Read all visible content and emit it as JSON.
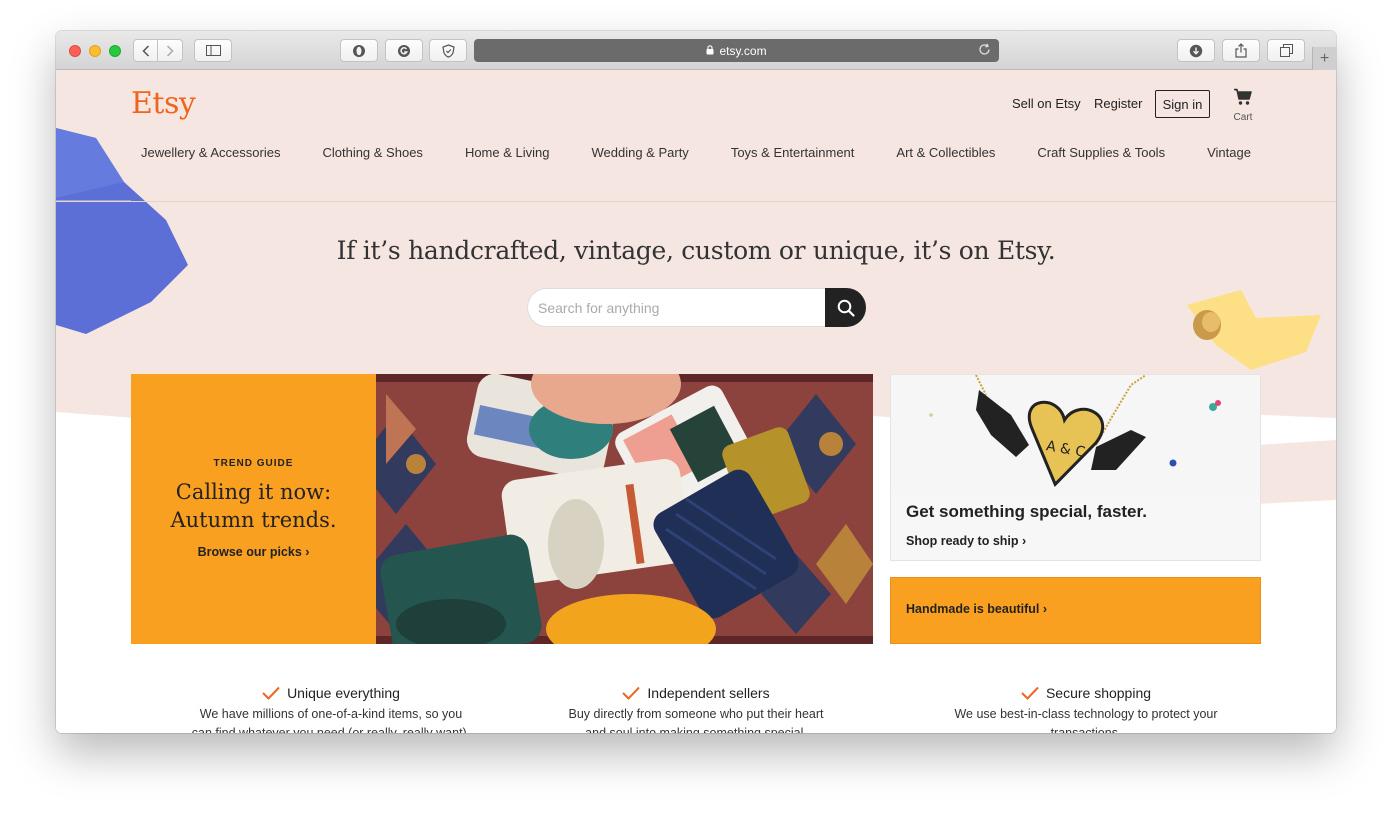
{
  "browser": {
    "url": "etsy.com",
    "new_tab_symbol": "+"
  },
  "header": {
    "logo": "Etsy",
    "sell_link": "Sell on Etsy",
    "register_link": "Register",
    "sign_in": "Sign in",
    "cart_label": "Cart"
  },
  "categories": [
    "Jewellery & Accessories",
    "Clothing & Shoes",
    "Home & Living",
    "Wedding & Party",
    "Toys & Entertainment",
    "Art & Collectibles",
    "Craft Supplies & Tools",
    "Vintage"
  ],
  "hero": {
    "headline": "If it’s handcrafted, vintage, custom or unique, it’s on Etsy.",
    "search_placeholder": "Search for anything"
  },
  "trend": {
    "eyebrow": "TREND GUIDE",
    "title_line1": "Calling it now:",
    "title_line2": "Autumn trends.",
    "link": "Browse our picks ›"
  },
  "ship_card": {
    "necklace_text": "A & C",
    "title": "Get something special, faster.",
    "link": "Shop ready to ship ›"
  },
  "handmade_card": {
    "link": "Handmade is beautiful ›"
  },
  "value_props": [
    {
      "title": "Unique everything",
      "line1": "We have millions of one-of-a-kind items, so you",
      "line2": "can find whatever you need (or really, really want)."
    },
    {
      "title": "Independent sellers",
      "line1": "Buy directly from someone who put their heart",
      "line2": "and soul into making something special."
    },
    {
      "title": "Secure shopping",
      "line1": "We use best-in-class technology to protect your",
      "line2": "transactions."
    }
  ],
  "colors": {
    "brand": "#f1641e",
    "accent_orange": "#f9a020",
    "hero_background": "#f5e6e1"
  }
}
